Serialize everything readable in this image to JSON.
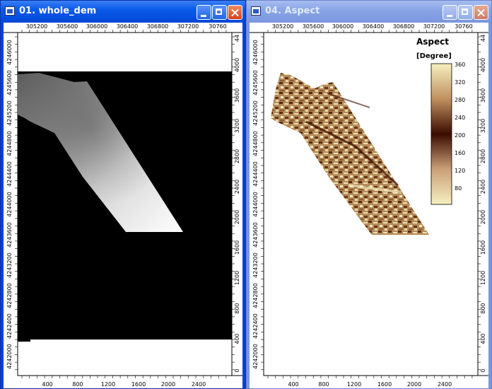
{
  "windows": {
    "left": {
      "title": "01. whole_dem",
      "top_ticks": [
        "305200",
        "305600",
        "306000",
        "306400",
        "306800",
        "307200",
        "30760"
      ],
      "bottom_ticks": [
        "400",
        "800",
        "1200",
        "1600",
        "2000",
        "2400"
      ],
      "left_ticks": [
        "4246000",
        "4245600",
        "4245200",
        "4244800",
        "4244400",
        "4244000",
        "4243600",
        "4243200",
        "4242800",
        "4242400",
        "4242000"
      ],
      "right_ticks": [
        "44",
        "4000",
        "3600",
        "3200",
        "2800",
        "2400",
        "2000",
        "1600",
        "1200",
        "800",
        "400",
        "0"
      ]
    },
    "right": {
      "title": "04. Aspect",
      "top_ticks": [
        "305200",
        "305600",
        "306000",
        "306400",
        "306800",
        "307200",
        "30760"
      ],
      "bottom_ticks": [
        "400",
        "800",
        "1200",
        "1600",
        "2000",
        "2400"
      ],
      "left_ticks": [
        "4246000",
        "4245600",
        "4245200",
        "4244800",
        "4244400",
        "4244000",
        "4243600",
        "4243200",
        "4242800",
        "4242400",
        "4242000"
      ],
      "right_ticks": [
        "44",
        "4000",
        "3600",
        "3200",
        "2800",
        "2400",
        "2000",
        "1600",
        "1200",
        "800",
        "400",
        "0"
      ],
      "legend": {
        "title": "Aspect",
        "unit": "[Degree]",
        "labels": [
          "360",
          "320",
          "280",
          "240",
          "200",
          "160",
          "120",
          "80"
        ]
      }
    }
  },
  "colors": {
    "active_title": "#0a5ae8",
    "inactive_title": "#7a96df",
    "aspect_dark": "#3a0c00",
    "aspect_light": "#f6efc0"
  },
  "icons": {
    "window_icon": "map-window-icon",
    "minimize": "minimize-icon",
    "maximize": "maximize-icon",
    "close": "close-icon"
  }
}
